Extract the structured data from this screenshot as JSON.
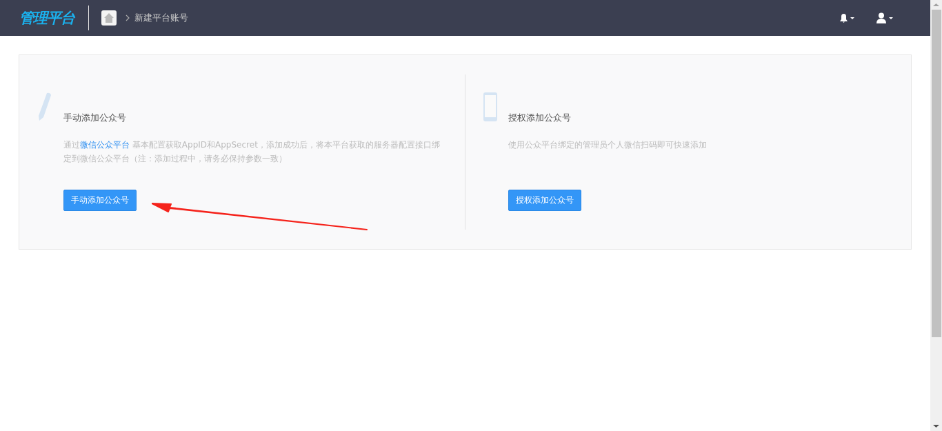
{
  "header": {
    "logo": "管理平台",
    "breadcrumb": [
      "新建平台账号"
    ]
  },
  "options": [
    {
      "kind": "manual",
      "title": "手动添加公众号",
      "description": {
        "before": "通过",
        "link": "微信公众平台",
        "after": " 基本配置获取AppID和AppSecret，添加成功后，将本平台获取的服务器配置接口绑定到微信公众平台（注：添加过程中，请务必保持参数一致）"
      },
      "button": "手动添加公众号"
    },
    {
      "kind": "authorize",
      "title": "授权添加公众号",
      "description": {
        "before": "使用公众平台绑定的管理员个人微信扫码即可快速添加"
      },
      "button": "授权添加公众号"
    }
  ]
}
